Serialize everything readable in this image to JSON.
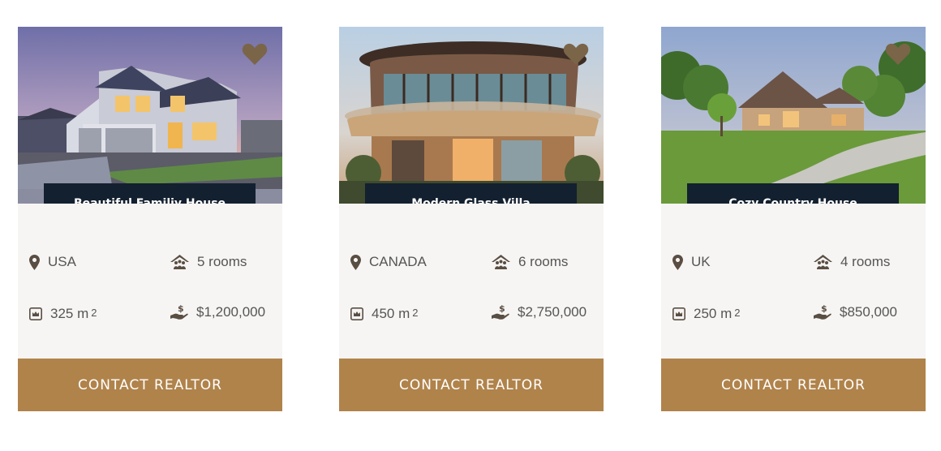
{
  "colors": {
    "card_bg": "#f6f5f3",
    "title_bg": "#13202f",
    "accent": "#b0834b",
    "heart": "#7a6549",
    "text": "#555555"
  },
  "cards": [
    {
      "image": "suburban-house-photo",
      "title": "Beautiful Familiy House",
      "location": "USA",
      "rooms": "5 rooms",
      "area": "325 m",
      "area_unit_sup": "2",
      "price": "$1,200,000",
      "button": "CONTACT REALTOR"
    },
    {
      "image": "modern-round-villa-photo",
      "title": "Modern Glass Villa",
      "location": "CANADA",
      "rooms": "6 rooms",
      "area": "450 m",
      "area_unit_sup": "2",
      "price": "$2,750,000",
      "button": "CONTACT REALTOR"
    },
    {
      "image": "country-house-photo",
      "title": "Cozy Country House",
      "location": "UK",
      "rooms": "4 rooms",
      "area": "250 m",
      "area_unit_sup": "2",
      "price": "$850,000",
      "button": "CONTACT REALTOR"
    }
  ],
  "icons": {
    "favorite": "heart-icon",
    "location": "map-pin-icon",
    "rooms": "house-people-icon",
    "area": "area-icon",
    "price": "hand-dollar-icon"
  }
}
